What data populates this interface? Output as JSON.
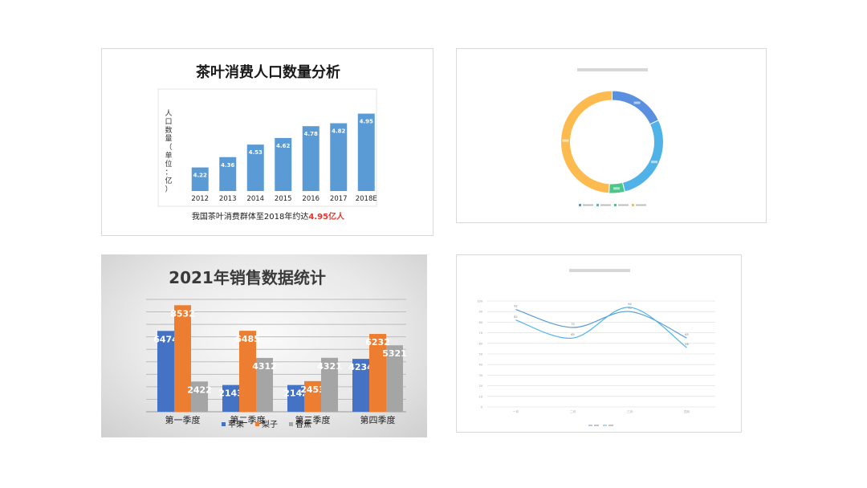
{
  "chart_data": [
    {
      "type": "bar",
      "title": "茶叶消费人口数量分析",
      "ylabel": "人口数量（单位：亿）",
      "categories": [
        "2012",
        "2013",
        "2014",
        "2015",
        "2016",
        "2017",
        "2018E"
      ],
      "values": [
        4.22,
        4.36,
        4.53,
        4.62,
        4.78,
        4.82,
        4.95
      ],
      "ylim": [
        3.9,
        5.0
      ],
      "caption_prefix": "我国茶叶消费群体至2018年约达",
      "caption_highlight": "4.95亿人",
      "bar_color": "#5b9bd5",
      "highlight_color": "#e8352b"
    },
    {
      "type": "pie",
      "donut": true,
      "slices": [
        {
          "value": 18,
          "color": "#5b8fe0"
        },
        {
          "value": 28,
          "color": "#4fb3e8"
        },
        {
          "value": 5,
          "color": "#4cc58b"
        },
        {
          "value": 49,
          "color": "#fdbb4f"
        }
      ]
    },
    {
      "type": "bar",
      "title": "2021年销售数据统计",
      "categories": [
        "第一季度",
        "第二季度",
        "第三季度",
        "第四季度"
      ],
      "series": [
        {
          "name": "苹果",
          "values": [
            6474,
            2143,
            2142,
            4234
          ],
          "color": "#4472c4"
        },
        {
          "name": "梨子",
          "values": [
            8532,
            6485,
            2453,
            6232
          ],
          "color": "#ed7d31"
        },
        {
          "name": "香蕉",
          "values": [
            2422,
            4312,
            4321,
            5321
          ],
          "color": "#a5a5a5"
        }
      ],
      "ylim": [
        0,
        9000
      ],
      "grid": true,
      "legend": "bottom"
    },
    {
      "type": "line",
      "x": [
        "一月",
        "二月",
        "三月",
        "四月"
      ],
      "series": [
        {
          "values": [
            92,
            75,
            90,
            65
          ],
          "color": "#5b9bd5"
        },
        {
          "values": [
            82,
            65,
            94,
            56
          ],
          "color": "#4fb3e8"
        }
      ],
      "ylim": [
        0,
        100
      ],
      "yticks": [
        0,
        10,
        20,
        30,
        40,
        50,
        60,
        70,
        80,
        90,
        100
      ],
      "legend": "bottom"
    }
  ]
}
